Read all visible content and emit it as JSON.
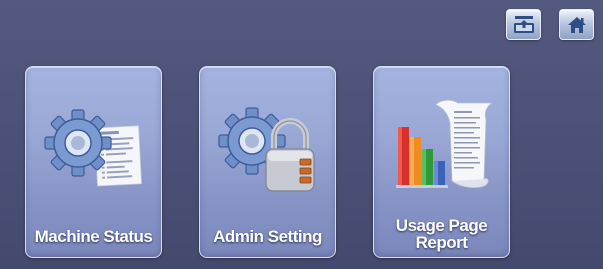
{
  "top_bar": {
    "buttons": [
      {
        "icon": "tray-upload-icon"
      },
      {
        "icon": "home-icon"
      }
    ]
  },
  "tiles": [
    {
      "label": "Machine Status",
      "icon": "gear-document-icon"
    },
    {
      "label": "Admin Setting",
      "icon": "gear-padlock-icon"
    },
    {
      "label": "Usage Page\nReport",
      "icon": "bar-chart-report-icon"
    }
  ],
  "colors": {
    "background": "#4a5075",
    "tile": "#98a6d4",
    "text": "#ffffff",
    "chart_red": "#d7302a",
    "chart_orange": "#ef8b1f",
    "chart_green": "#2e9a3a",
    "chart_blue": "#3a62b8"
  }
}
